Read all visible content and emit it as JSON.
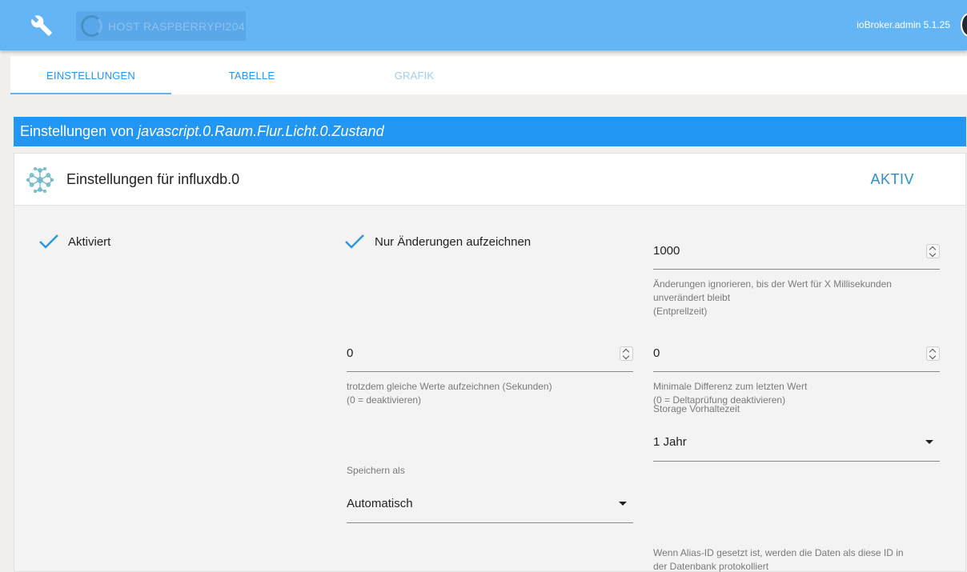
{
  "topbar": {
    "host_label": "HOST RASPBERRYPI204",
    "version": "ioBroker.admin 5.1.25",
    "wrench_icon": "wrench-icon",
    "bg_color": "#64b5f6"
  },
  "tabs": [
    {
      "label": "EINSTELLUNGEN"
    },
    {
      "label": "TABELLE"
    },
    {
      "label": "GRAFIK"
    }
  ],
  "heading": {
    "prefix": "Einstellungen von",
    "object_id": "javascript.0.Raum.Flur.Licht.0.Zustand"
  },
  "panel": {
    "title": "Einstellungen für influxdb.0",
    "status": "AKTIV",
    "icon": "influxdb-icon"
  },
  "form": {
    "enabled_label": "Aktiviert",
    "changes_only_label": "Nur Änderungen aufzeichnen",
    "debounce": {
      "value": "1000",
      "helper_line1": "Änderungen ignorieren, bis der Wert für X Millisekunden",
      "helper_line2": "unverändert bleibt",
      "helper_line3": "(Entprellzeit)"
    },
    "still_record": {
      "value": "0",
      "helper_line1": "trotzdem gleiche Werte aufzeichnen (Sekunden)",
      "helper_line2": "(0 = deaktivieren)"
    },
    "min_diff": {
      "value": "0",
      "helper_line1": "Minimale Differenz zum letzten Wert",
      "helper_line2": "(0 = Deltaprüfung deaktivieren)"
    },
    "retention": {
      "label": "Storage Vorhaltezeit",
      "value": "1 Jahr"
    },
    "store_as": {
      "label": "Speichern als",
      "value": "Automatisch"
    },
    "alias_helper_line1": "Wenn Alias-ID gesetzt ist, werden die Daten als diese ID in",
    "alias_helper_line2": "der Datenbank protokolliert"
  }
}
